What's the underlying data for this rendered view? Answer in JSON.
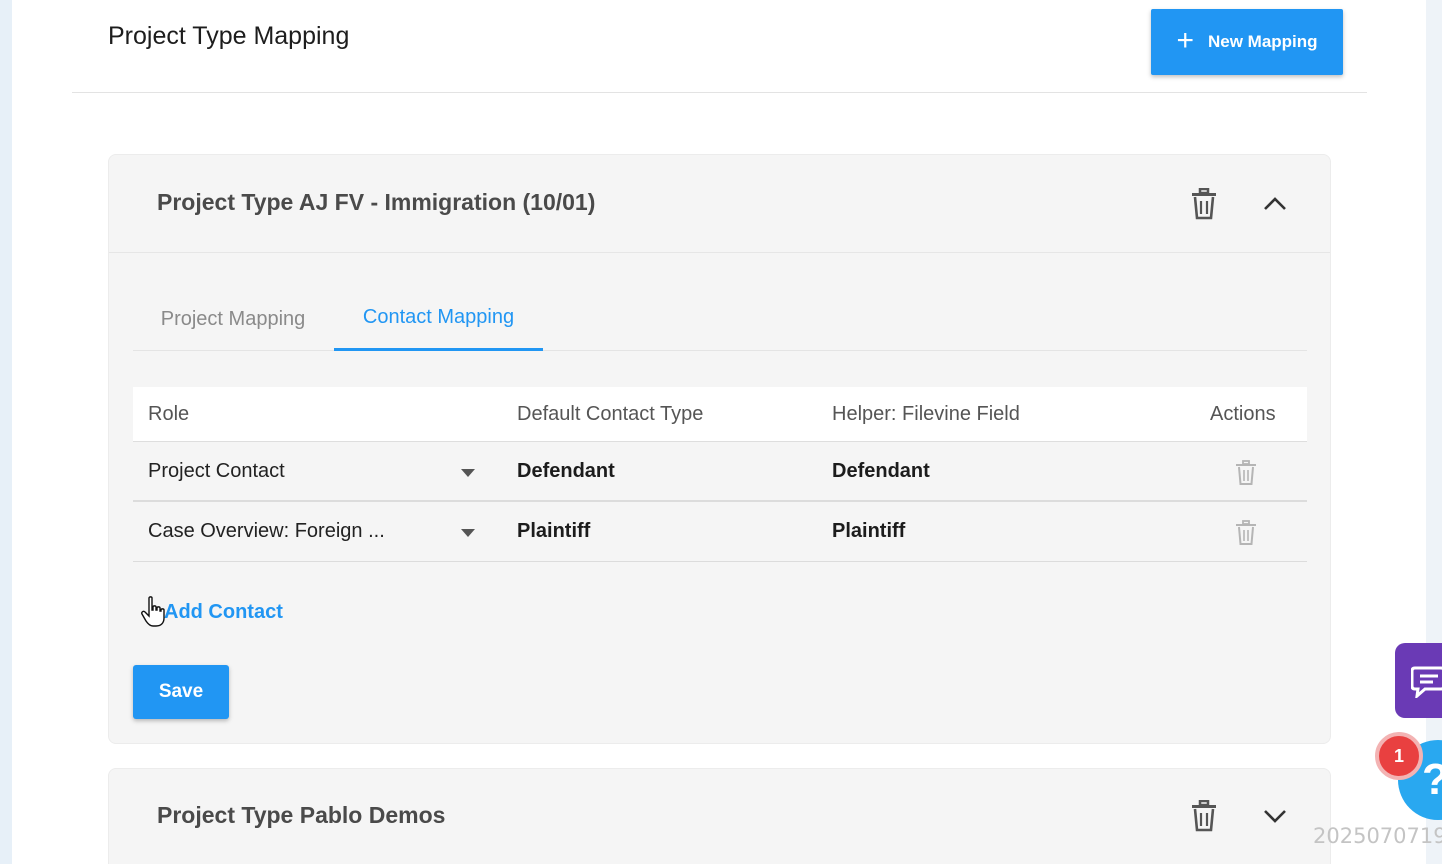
{
  "header": {
    "title": "Project Type Mapping",
    "new_mapping_label": "New Mapping"
  },
  "panels": [
    {
      "title": "Project Type AJ FV - Immigration (10/01)",
      "expanded": true,
      "tabs": [
        {
          "label": "Project Mapping",
          "active": false
        },
        {
          "label": "Contact Mapping",
          "active": true
        }
      ],
      "table": {
        "columns": [
          "Role",
          "Default Contact Type",
          "Helper: Filevine Field",
          "Actions"
        ],
        "rows": [
          {
            "role": "Project Contact",
            "default_contact_type": "Defendant",
            "helper_field": "Defendant"
          },
          {
            "role": "Case Overview: Foreign ...",
            "default_contact_type": "Plaintiff",
            "helper_field": "Plaintiff"
          }
        ]
      },
      "add_contact_label": "Add Contact",
      "save_label": "Save"
    },
    {
      "title": "Project Type Pablo Demos",
      "expanded": false
    }
  ],
  "widgets": {
    "help_badge_count": "1",
    "help_symbol": "?"
  },
  "watermark": "2025070719",
  "colors": {
    "accent": "#2196f3",
    "chat_widget": "#6a3ab5",
    "help_widget": "#29a8f0",
    "badge": "#e94040"
  }
}
